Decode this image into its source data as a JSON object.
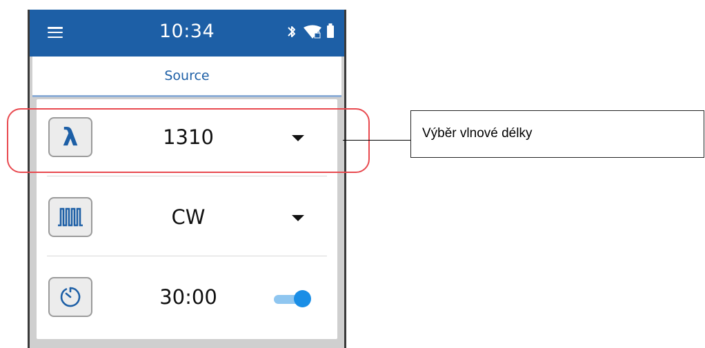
{
  "status_bar": {
    "time": "10:34",
    "icons": [
      "menu-icon",
      "bluetooth-icon",
      "wifi-lock-icon",
      "battery-icon"
    ]
  },
  "tab": {
    "label": "Source"
  },
  "settings": [
    {
      "name": "wavelength",
      "icon": "lambda-icon",
      "icon_glyph": "λ",
      "value": "1310",
      "control": "dropdown"
    },
    {
      "name": "modulation",
      "icon": "pulse-waveform-icon",
      "value": "CW",
      "control": "dropdown"
    },
    {
      "name": "timer",
      "icon": "timer-icon",
      "value": "30:00",
      "control": "toggle",
      "toggle_on": true
    }
  ],
  "callout": {
    "text": "Výběr vlnové délky"
  },
  "colors": {
    "status_bar": "#1d5fa6",
    "accent": "#1d5fa6",
    "highlight_border": "#e8484e",
    "toggle_active": "#1a8ee6"
  }
}
